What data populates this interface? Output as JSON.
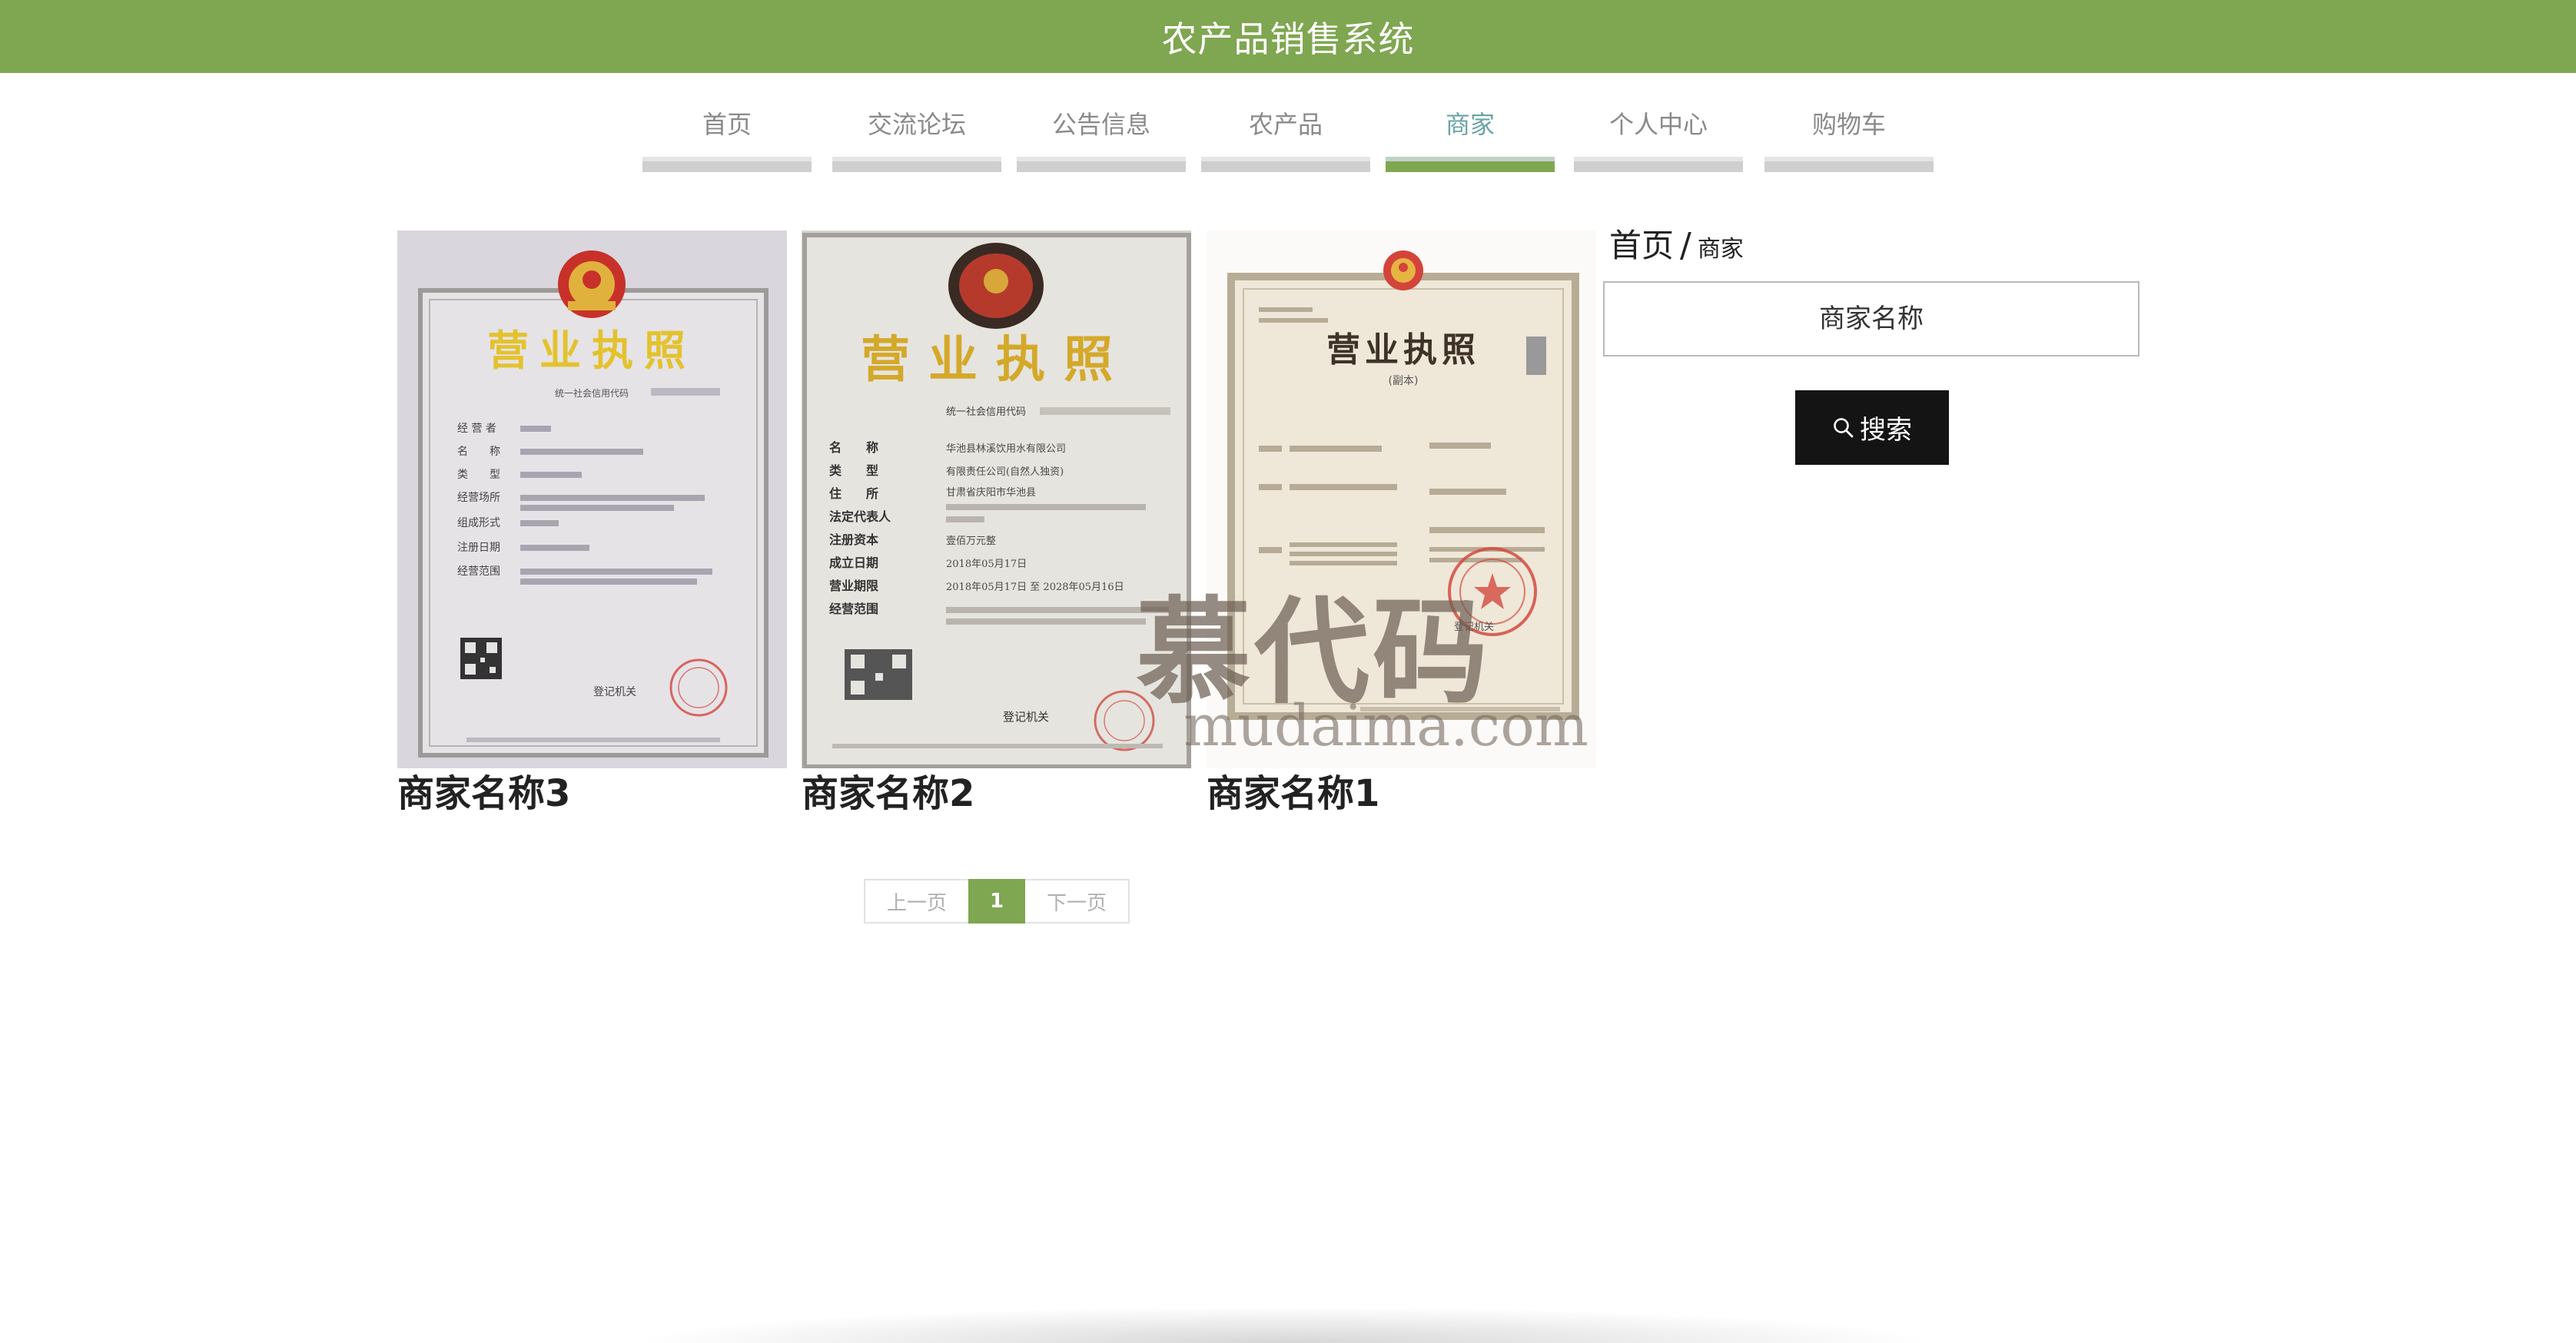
{
  "app": {
    "title": "农产品销售系统"
  },
  "nav": {
    "items": [
      {
        "label": "首页",
        "active": false
      },
      {
        "label": "交流论坛",
        "active": false
      },
      {
        "label": "公告信息",
        "active": false
      },
      {
        "label": "农产品",
        "active": false
      },
      {
        "label": "商家",
        "active": true
      },
      {
        "label": "个人中心",
        "active": false
      },
      {
        "label": "购物车",
        "active": false
      }
    ]
  },
  "merchants": [
    {
      "name": "商家名称3",
      "license": {
        "heading": "营业执照",
        "code_label": "统一社会信用代码",
        "fields": [
          {
            "label": "经 营 者"
          },
          {
            "label": "名　　称"
          },
          {
            "label": "类　　型"
          },
          {
            "label": "经营场所"
          },
          {
            "label": "组成形式"
          },
          {
            "label": "注册日期"
          },
          {
            "label": "经营范围"
          }
        ],
        "authority": "登记机关"
      }
    },
    {
      "name": "商家名称2",
      "license": {
        "heading": "营业执照",
        "code_label": "统一社会信用代码",
        "fields": [
          {
            "label": "名　　称",
            "value": "华池县林溪饮用水有限公司"
          },
          {
            "label": "类　　型",
            "value": "有限责任公司(自然人独资)"
          },
          {
            "label": "住　　所",
            "value": "甘肃省庆阳市华池县"
          },
          {
            "label": "法定代表人"
          },
          {
            "label": "注册资本",
            "value": "壹佰万元整"
          },
          {
            "label": "成立日期",
            "value": "2018年05月17日"
          },
          {
            "label": "营业期限",
            "value": "2018年05月17日 至 2028年05月16日"
          },
          {
            "label": "经营范围"
          }
        ],
        "authority": "登记机关"
      }
    },
    {
      "name": "商家名称1",
      "license": {
        "heading": "营业执照",
        "sub": "(副本)",
        "authority": "登记机关"
      }
    }
  ],
  "sidebar": {
    "breadcrumb_home": "首页",
    "breadcrumb_sep": "/",
    "breadcrumb_current": "商家",
    "search_placeholder": "商家名称",
    "search_button": "搜索"
  },
  "pagination": {
    "prev": "上一页",
    "current": "1",
    "next": "下一页"
  },
  "watermark": {
    "cn": "慕代码",
    "en": "mudaima.com"
  },
  "colors": {
    "brand_green": "#7fa650",
    "nav_active_text": "#6aa3a8",
    "button_dark": "#141414"
  }
}
